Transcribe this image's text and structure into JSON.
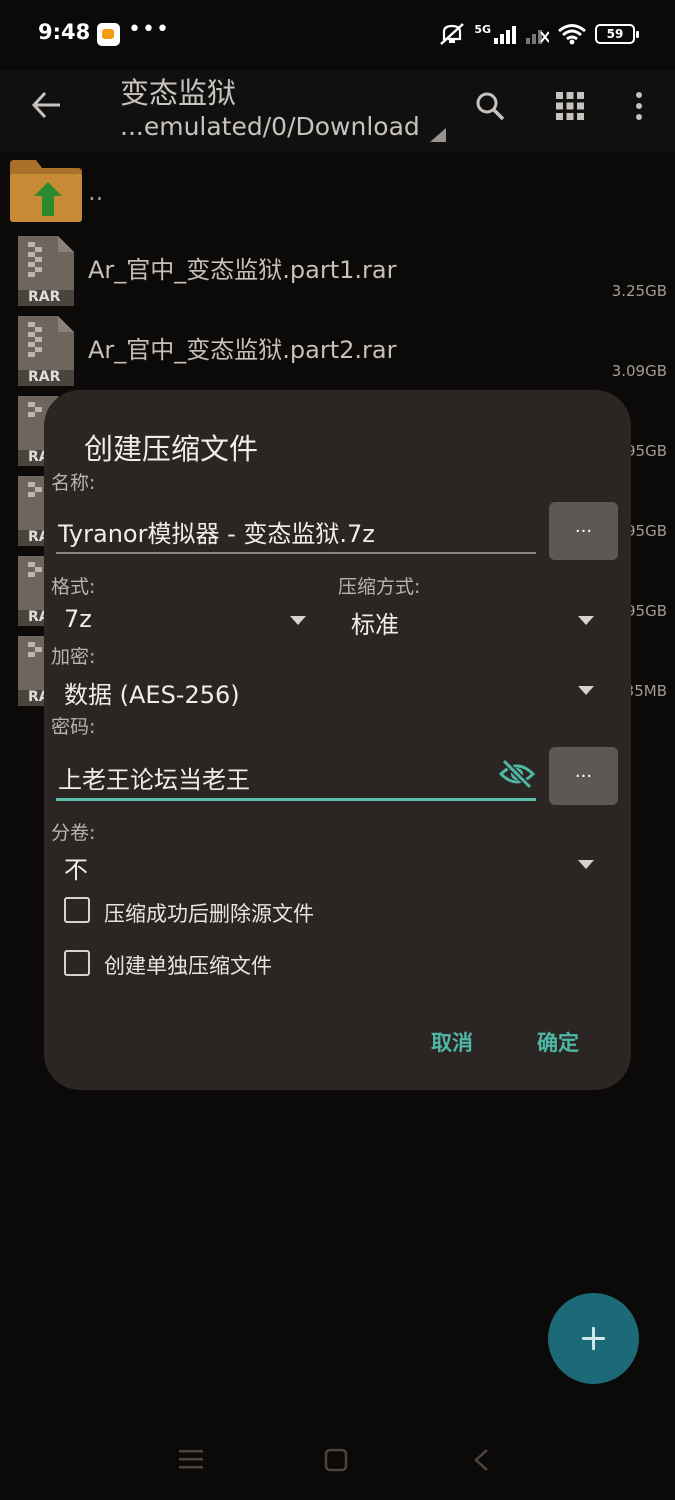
{
  "status_bar": {
    "time": "9:48",
    "overflow": "•••",
    "network": "5G",
    "battery": "59"
  },
  "app_bar": {
    "title": "变态监狱",
    "path": "...emulated/0/Download"
  },
  "files": [
    {
      "name": "..",
      "size": ""
    },
    {
      "name": "Ar_官中_变态监狱.part1.rar",
      "size": "3.25GB",
      "badge": "RAR"
    },
    {
      "name": "Ar_官中_变态监狱.part2.rar",
      "size": "3.09GB",
      "badge": "RAR"
    },
    {
      "size_tail": "95GB",
      "badge_tail": "RA"
    },
    {
      "size_tail": "95GB",
      "badge_tail": "RA"
    },
    {
      "size_tail": "95GB",
      "badge_tail": "RA"
    },
    {
      "size_tail": "35MB",
      "badge_tail": "RA"
    }
  ],
  "dialog": {
    "title": "创建压缩文件",
    "name_label": "名称:",
    "name_value": "Tyranor模拟器 - 变态监狱.7z",
    "browse_label": "...",
    "format_label": "格式:",
    "format_value": "7z",
    "method_label": "压缩方式:",
    "method_value": "标准",
    "encryption_label": "加密:",
    "encryption_value": "数据 (AES-256)",
    "password_label": "密码:",
    "password_value": "上老王论坛当老王",
    "password_browse": "...",
    "split_label": "分卷:",
    "split_value": "不",
    "delete_after_label": "压缩成功后删除源文件",
    "separate_label": "创建单独压缩文件",
    "cancel": "取消",
    "ok": "确定"
  }
}
